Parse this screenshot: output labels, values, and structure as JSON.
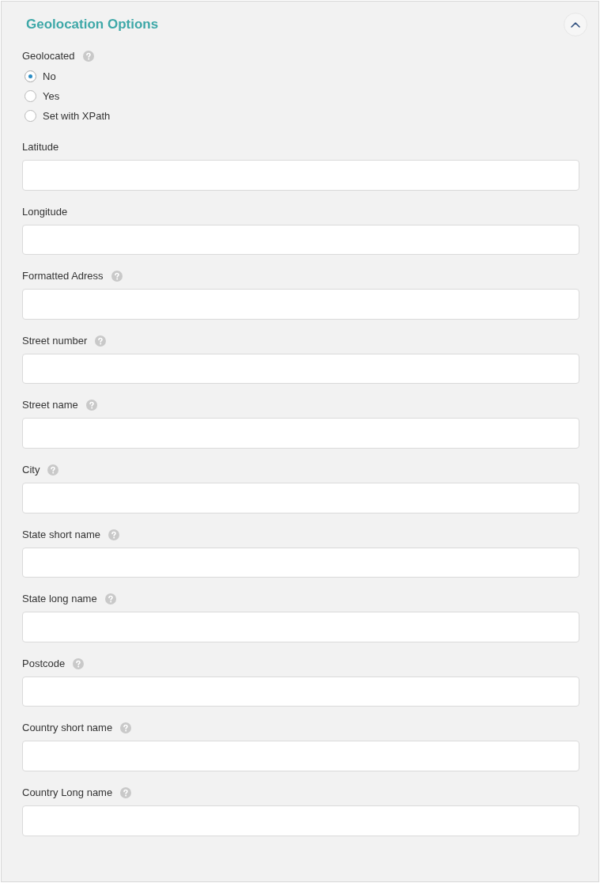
{
  "section": {
    "title": "Geolocation Options",
    "expanded": true
  },
  "geolocated": {
    "label": "Geolocated",
    "help": true,
    "options": [
      {
        "label": "No",
        "selected": true
      },
      {
        "label": "Yes",
        "selected": false
      },
      {
        "label": "Set with XPath",
        "selected": false
      }
    ]
  },
  "fields": [
    {
      "label": "Latitude",
      "help": false
    },
    {
      "label": "Longitude",
      "help": false
    },
    {
      "label": "Formatted Adress",
      "help": true
    },
    {
      "label": "Street number",
      "help": true
    },
    {
      "label": "Street name",
      "help": true
    },
    {
      "label": "City",
      "help": true
    },
    {
      "label": "State short name",
      "help": true
    },
    {
      "label": "State long name",
      "help": true
    },
    {
      "label": "Postcode",
      "help": true
    },
    {
      "label": "Country short name",
      "help": true
    },
    {
      "label": "Country Long name",
      "help": true
    }
  ]
}
